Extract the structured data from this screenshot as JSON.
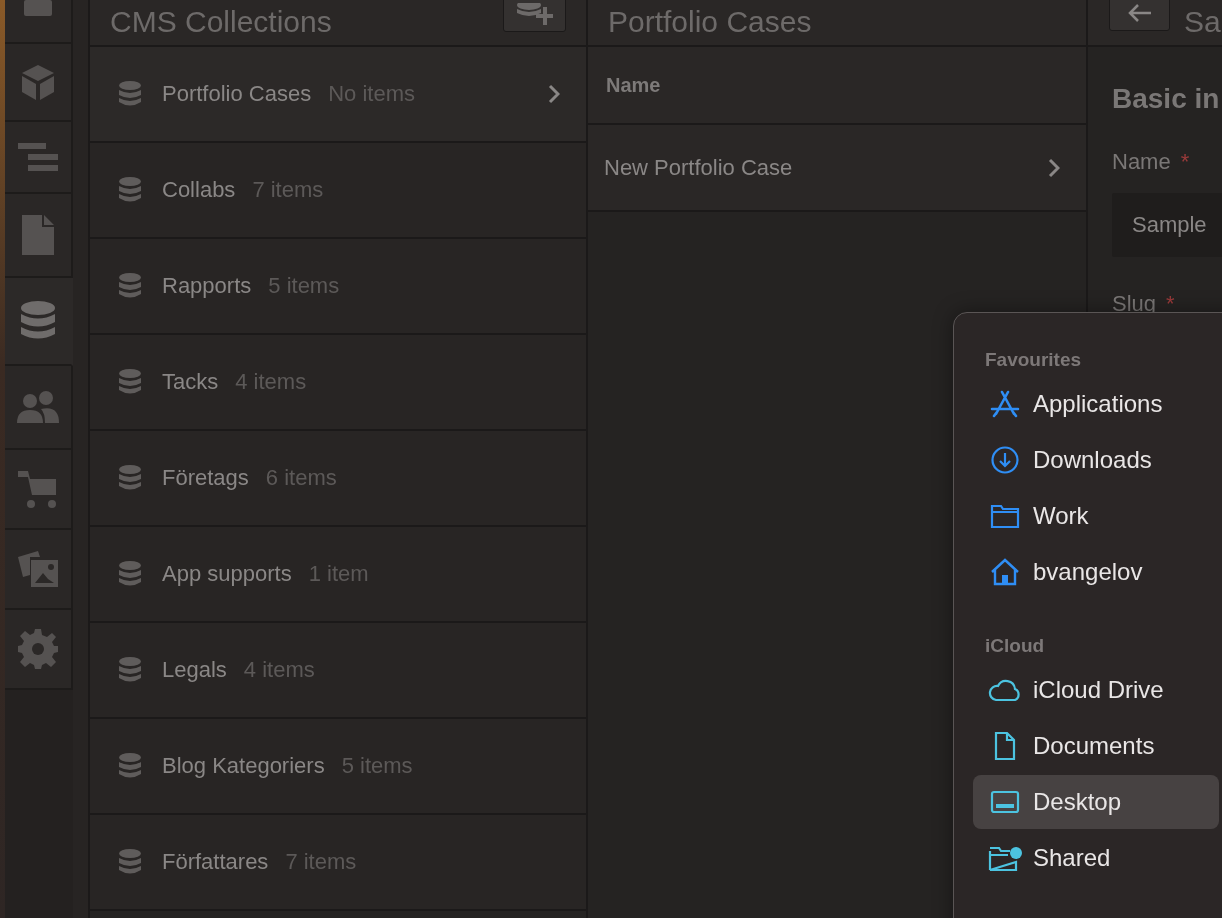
{
  "nav": [
    {
      "kind": "box",
      "selected": false
    },
    {
      "kind": "cube",
      "selected": false
    },
    {
      "kind": "lines",
      "selected": false
    },
    {
      "kind": "page",
      "selected": false
    },
    {
      "kind": "database",
      "selected": true
    },
    {
      "kind": "people",
      "selected": false
    },
    {
      "kind": "cart",
      "selected": false
    },
    {
      "kind": "images",
      "selected": false
    },
    {
      "kind": "gear",
      "selected": false
    }
  ],
  "collections": {
    "title": "CMS Collections",
    "items": [
      {
        "name": "Portfolio Cases",
        "count": "No items",
        "selected": true
      },
      {
        "name": "Collabs",
        "count": "7 items",
        "selected": false
      },
      {
        "name": "Rapports",
        "count": "5 items",
        "selected": false
      },
      {
        "name": "Tacks",
        "count": "4 items",
        "selected": false
      },
      {
        "name": "Företags",
        "count": "6 items",
        "selected": false
      },
      {
        "name": "App supports",
        "count": "1 item",
        "selected": false
      },
      {
        "name": "Legals",
        "count": "4 items",
        "selected": false
      },
      {
        "name": "Blog Kategoriers",
        "count": "5 items",
        "selected": false
      },
      {
        "name": "Författares",
        "count": "7 items",
        "selected": false
      }
    ]
  },
  "table": {
    "title": "Portfolio Cases",
    "columns": [
      "Name"
    ],
    "rows": [
      {
        "name": "New Portfolio Case"
      }
    ]
  },
  "editor": {
    "title": "Sa",
    "section": "Basic in",
    "fields": [
      {
        "label": "Name",
        "required_mark": "*",
        "value": "Sample"
      },
      {
        "label": "Slug",
        "required_mark": "*"
      }
    ]
  },
  "popup": {
    "sections": [
      {
        "title": "Favourites",
        "items": [
          {
            "label": "Applications",
            "kind": "apps",
            "selected": false
          },
          {
            "label": "Downloads",
            "kind": "download",
            "selected": false
          },
          {
            "label": "Work",
            "kind": "folder",
            "selected": false
          },
          {
            "label": "bvangelov",
            "kind": "home",
            "selected": false
          }
        ]
      },
      {
        "title": "iCloud",
        "items": [
          {
            "label": "iCloud Drive",
            "kind": "cloud",
            "selected": false
          },
          {
            "label": "Documents",
            "kind": "doc",
            "selected": false
          },
          {
            "label": "Desktop",
            "kind": "desktop",
            "selected": true
          },
          {
            "label": "Shared",
            "kind": "shared",
            "selected": false
          }
        ]
      }
    ]
  }
}
